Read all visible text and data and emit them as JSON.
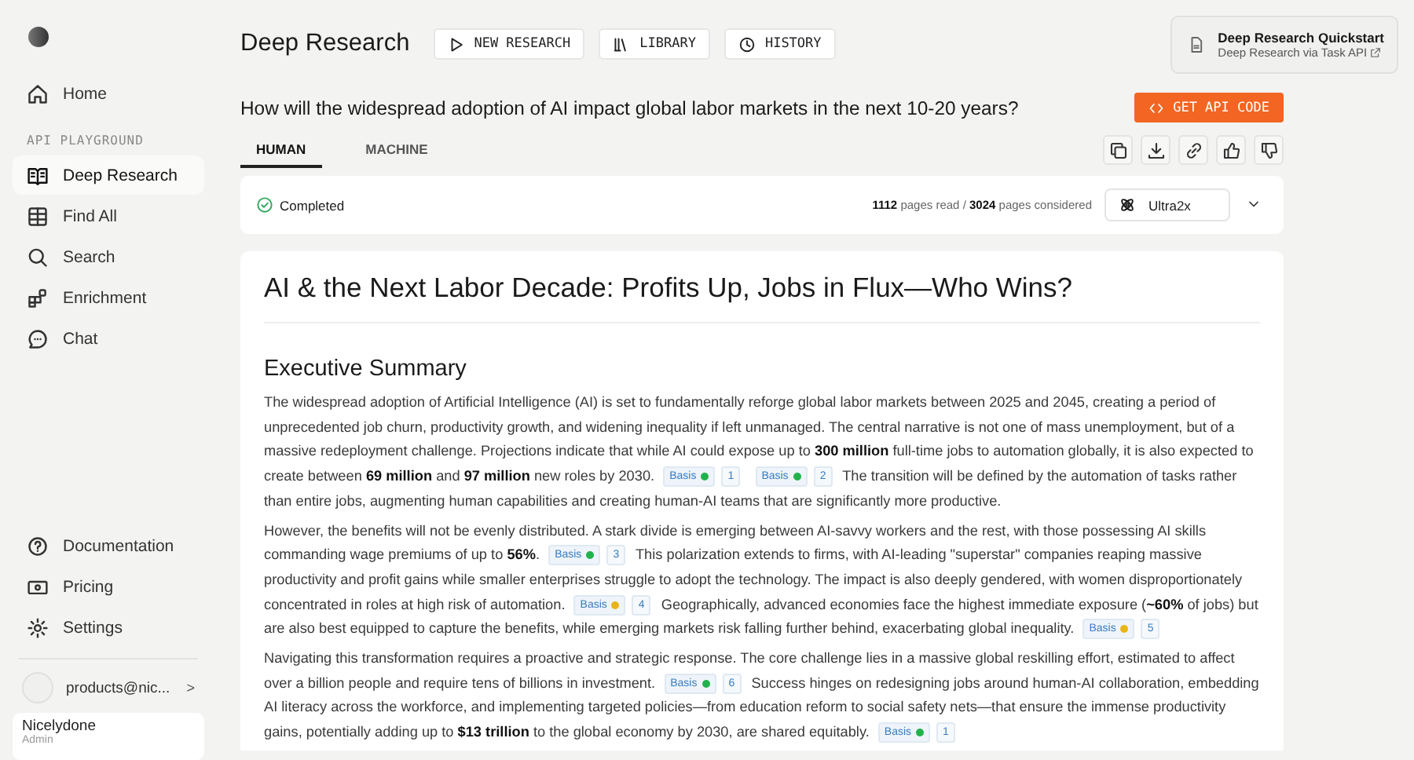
{
  "sidebar": {
    "top_items": [
      {
        "kind": "home",
        "label": "Home",
        "selected": false
      }
    ],
    "section_label": "API PLAYGROUND",
    "playground_items": [
      {
        "kind": "book",
        "label": "Deep Research",
        "selected": true
      },
      {
        "kind": "table",
        "label": "Find All",
        "selected": false
      },
      {
        "kind": "search",
        "label": "Search",
        "selected": false
      },
      {
        "kind": "blocks",
        "label": "Enrichment",
        "selected": false
      },
      {
        "kind": "chat",
        "label": "Chat",
        "selected": false
      }
    ],
    "bottom_items": [
      {
        "kind": "help",
        "label": "Documentation",
        "selected": false
      },
      {
        "kind": "money",
        "label": "Pricing",
        "selected": false
      },
      {
        "kind": "gear",
        "label": "Settings",
        "selected": false
      }
    ],
    "account": {
      "email": "products@nic...",
      "chevron": ">"
    },
    "org": {
      "name": "Nicelydone",
      "role": "Admin"
    }
  },
  "header": {
    "title": "Deep Research",
    "buttons": [
      {
        "kind": "play",
        "label": "NEW RESEARCH"
      },
      {
        "kind": "library",
        "label": "LIBRARY"
      },
      {
        "kind": "clock",
        "label": "HISTORY"
      }
    ]
  },
  "quickstart": {
    "title": "Deep Research Quickstart",
    "link": "Deep Research via Task API"
  },
  "question": "How will the widespread adoption of AI impact global labor markets in the next 10-20 years?",
  "api_button": {
    "label": "GET API CODE"
  },
  "tabs": [
    {
      "label": "HUMAN",
      "selected": true
    },
    {
      "label": "MACHINE",
      "selected": false
    }
  ],
  "actions": [
    {
      "kind": "copy"
    },
    {
      "kind": "download"
    },
    {
      "kind": "link"
    },
    {
      "kind": "thumbs-up"
    },
    {
      "kind": "thumbs-down"
    }
  ],
  "status": {
    "label": "Completed",
    "pages_read": "1112",
    "pages_read_label": "pages read",
    "separator": "/",
    "pages_considered": "3024",
    "pages_considered_label": "pages considered",
    "processor": "Ultra2x"
  },
  "report": {
    "title": "AI & the Next Labor Decade: Profits Up, Jobs in Flux—Who Wins?",
    "section": "Executive Summary",
    "paragraphs": [
      [
        {
          "kind": "text",
          "text": "The widespread adoption of Artificial Intelligence (AI) is set to fundamentally reforge global labor markets between 2025 and 2045, creating a period of unprecedented job churn, productivity growth, and widening inequality if left unmanaged. The central narrative is not one of mass unemployment, but of a massive redeployment challenge. Projections indicate that while AI could expose up to **300 million** full-time jobs to automation globally, it is also expected to create between **69 million** and **97 million** new roles by 2030."
        },
        {
          "kind": "cite",
          "label": "Basis",
          "color": "#22b24c",
          "number": "1"
        },
        {
          "kind": "cite",
          "label": "Basis",
          "color": "#22b24c",
          "number": "2"
        },
        {
          "kind": "text",
          "text": "The transition will be defined by the automation of tasks rather than entire jobs, augmenting human capabilities and creating human-AI teams that are significantly more productive."
        }
      ],
      [
        {
          "kind": "text",
          "text": "However, the benefits will not be evenly distributed. A stark divide is emerging between AI-savvy workers and the rest, with those possessing AI skills commanding wage premiums of up to **56%**."
        },
        {
          "kind": "cite",
          "label": "Basis",
          "color": "#22b24c",
          "number": "3"
        },
        {
          "kind": "text",
          "text": "This polarization extends to firms, with AI-leading \"superstar\" companies reaping massive productivity and profit gains while smaller enterprises struggle to adopt the technology. The impact is also deeply gendered, with women disproportionately concentrated in roles at high risk of automation."
        },
        {
          "kind": "cite",
          "label": "Basis",
          "color": "#e8b517",
          "number": "4"
        },
        {
          "kind": "text",
          "text": "Geographically, advanced economies face the highest immediate exposure (**~60%** of jobs) but are also best equipped to capture the benefits, while emerging markets risk falling further behind, exacerbating global inequality."
        },
        {
          "kind": "cite",
          "label": "Basis",
          "color": "#e8b517",
          "number": "5"
        }
      ],
      [
        {
          "kind": "text",
          "text": "Navigating this transformation requires a proactive and strategic response. The core challenge lies in a massive global reskilling effort, estimated to affect over a billion people and require tens of billions in investment."
        },
        {
          "kind": "cite",
          "label": "Basis",
          "color": "#22b24c",
          "number": "6"
        },
        {
          "kind": "text",
          "text": "Success hinges on redesigning jobs around human-AI collaboration, embedding AI literacy across the workforce, and implementing targeted policies—from education reform to social safety nets—that ensure the immense productivity gains, potentially adding up to **$13 trillion** to the global economy by 2030, are shared equitably."
        },
        {
          "kind": "cite",
          "label": "Basis",
          "color": "#22b24c",
          "number": "1"
        }
      ]
    ]
  }
}
